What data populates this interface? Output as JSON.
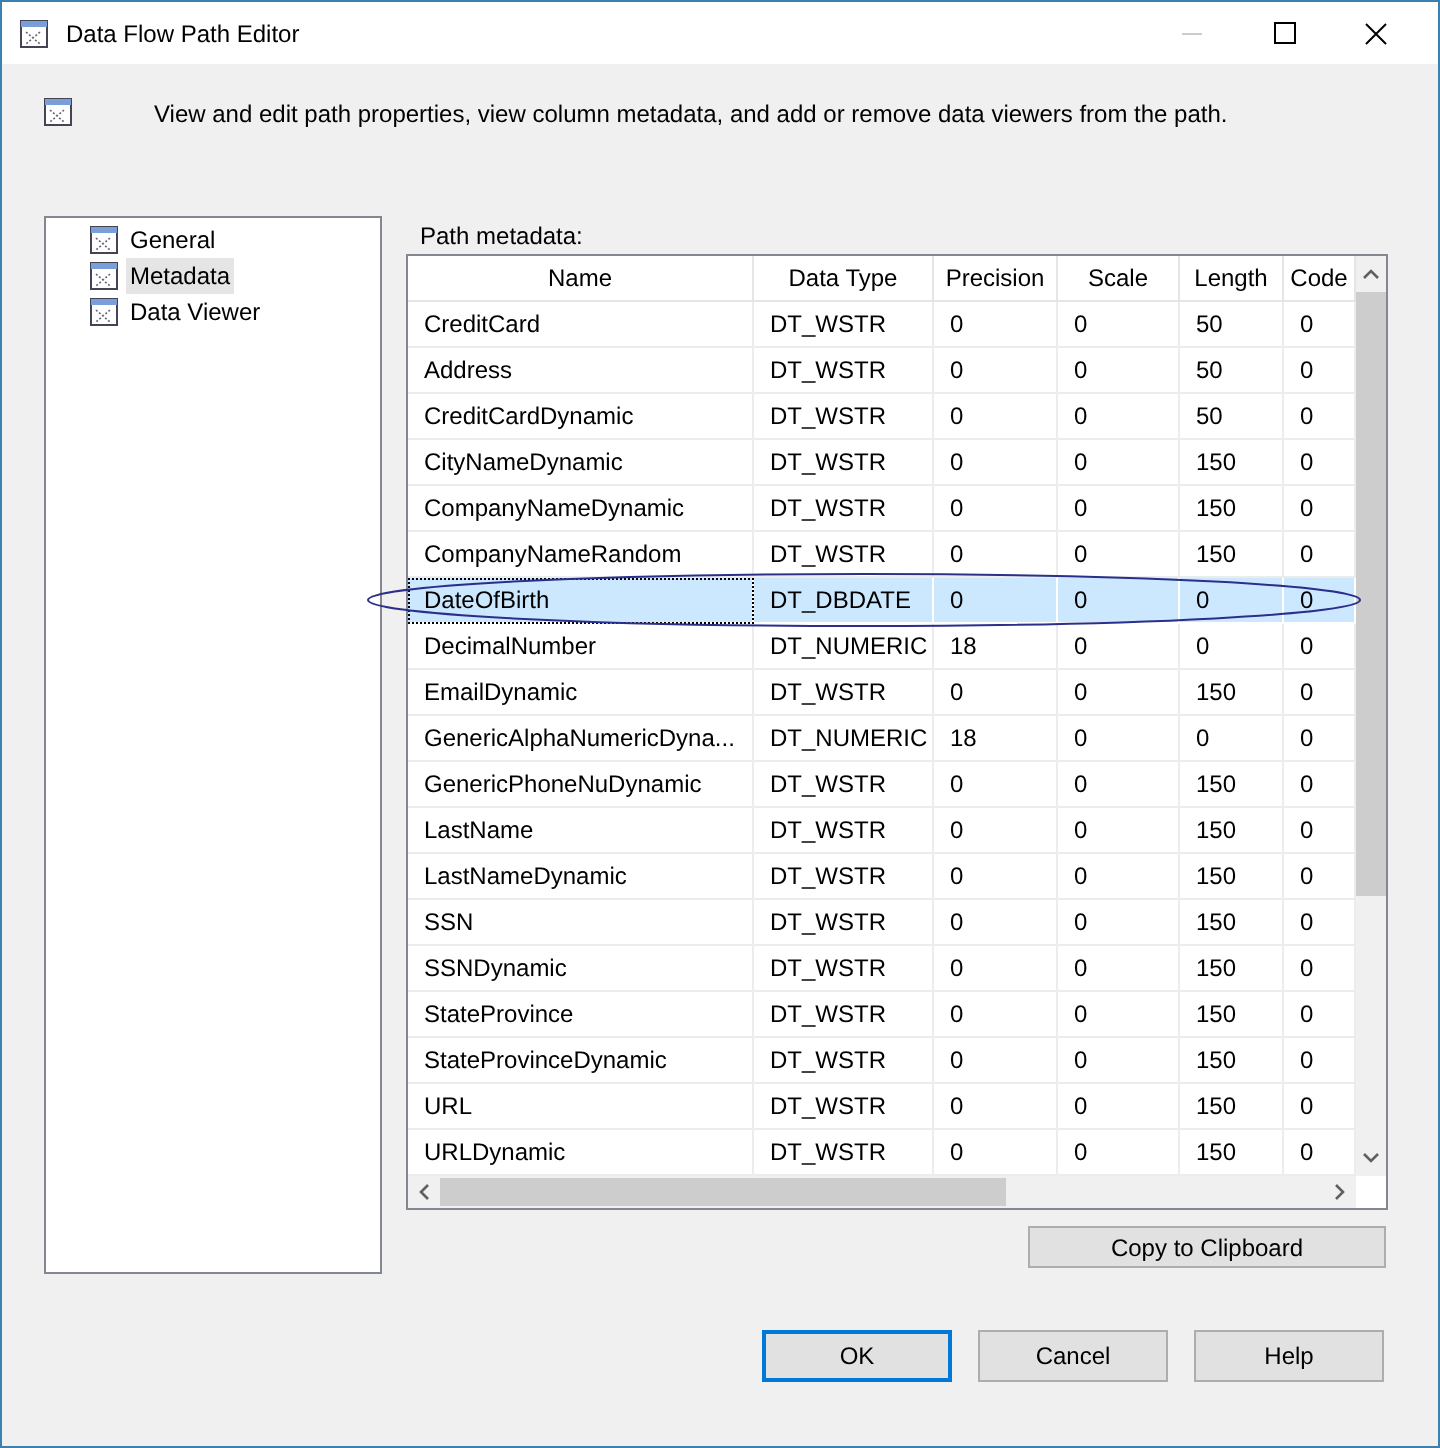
{
  "window": {
    "title": "Data Flow Path Editor",
    "minimize_disabled": true
  },
  "description": "View and edit path properties, view column metadata, and add or remove data viewers from the path.",
  "sidebar": {
    "items": [
      {
        "label": "General",
        "selected": false
      },
      {
        "label": "Metadata",
        "selected": true
      },
      {
        "label": "Data Viewer",
        "selected": false
      }
    ]
  },
  "metadata_label": "Path metadata:",
  "table": {
    "columns": [
      "Name",
      "Data Type",
      "Precision",
      "Scale",
      "Length",
      "Code"
    ],
    "rows": [
      {
        "cells": [
          "CreditCard",
          "DT_WSTR",
          "0",
          "0",
          "50",
          "0"
        ],
        "selected": false
      },
      {
        "cells": [
          "Address",
          "DT_WSTR",
          "0",
          "0",
          "50",
          "0"
        ],
        "selected": false
      },
      {
        "cells": [
          "CreditCardDynamic",
          "DT_WSTR",
          "0",
          "0",
          "50",
          "0"
        ],
        "selected": false
      },
      {
        "cells": [
          "CityNameDynamic",
          "DT_WSTR",
          "0",
          "0",
          "150",
          "0"
        ],
        "selected": false
      },
      {
        "cells": [
          "CompanyNameDynamic",
          "DT_WSTR",
          "0",
          "0",
          "150",
          "0"
        ],
        "selected": false
      },
      {
        "cells": [
          "CompanyNameRandom",
          "DT_WSTR",
          "0",
          "0",
          "150",
          "0"
        ],
        "selected": false
      },
      {
        "cells": [
          "DateOfBirth",
          "DT_DBDATE",
          "0",
          "0",
          "0",
          "0"
        ],
        "selected": true
      },
      {
        "cells": [
          "DecimalNumber",
          "DT_NUMERIC",
          "18",
          "0",
          "0",
          "0"
        ],
        "selected": false
      },
      {
        "cells": [
          "EmailDynamic",
          "DT_WSTR",
          "0",
          "0",
          "150",
          "0"
        ],
        "selected": false
      },
      {
        "cells": [
          "GenericAlphaNumericDyna...",
          "DT_NUMERIC",
          "18",
          "0",
          "0",
          "0"
        ],
        "selected": false
      },
      {
        "cells": [
          "GenericPhoneNuDynamic",
          "DT_WSTR",
          "0",
          "0",
          "150",
          "0"
        ],
        "selected": false
      },
      {
        "cells": [
          "LastName",
          "DT_WSTR",
          "0",
          "0",
          "150",
          "0"
        ],
        "selected": false
      },
      {
        "cells": [
          "LastNameDynamic",
          "DT_WSTR",
          "0",
          "0",
          "150",
          "0"
        ],
        "selected": false
      },
      {
        "cells": [
          "SSN",
          "DT_WSTR",
          "0",
          "0",
          "150",
          "0"
        ],
        "selected": false
      },
      {
        "cells": [
          "SSNDynamic",
          "DT_WSTR",
          "0",
          "0",
          "150",
          "0"
        ],
        "selected": false
      },
      {
        "cells": [
          "StateProvince",
          "DT_WSTR",
          "0",
          "0",
          "150",
          "0"
        ],
        "selected": false
      },
      {
        "cells": [
          "StateProvinceDynamic",
          "DT_WSTR",
          "0",
          "0",
          "150",
          "0"
        ],
        "selected": false
      },
      {
        "cells": [
          "URL",
          "DT_WSTR",
          "0",
          "0",
          "150",
          "0"
        ],
        "selected": false
      },
      {
        "cells": [
          "URLDynamic",
          "DT_WSTR",
          "0",
          "0",
          "150",
          "0"
        ],
        "selected": false
      }
    ]
  },
  "copy_button": "Copy to Clipboard",
  "buttons": [
    {
      "label": "OK",
      "default": true
    },
    {
      "label": "Cancel",
      "default": false
    },
    {
      "label": "Help",
      "default": false
    }
  ]
}
